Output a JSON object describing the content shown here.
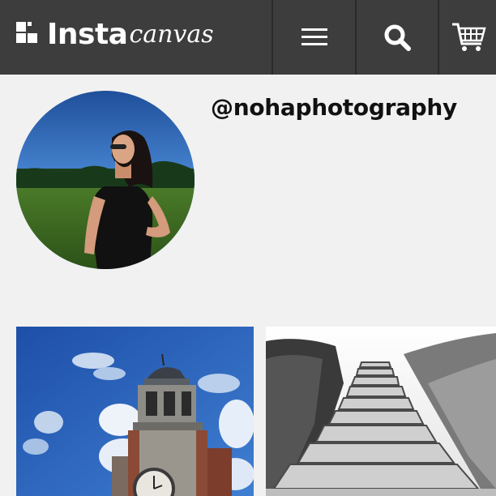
{
  "header": {
    "logo_bold": "Insta",
    "logo_script": "canvas",
    "menu_icon": "hamburger-menu-icon",
    "search_icon": "search-icon",
    "cart_icon": "shopping-cart-icon",
    "background_color": "#3d3d3d"
  },
  "profile": {
    "username": "@nohaphotography"
  },
  "photos": [
    {
      "name": "clock-tower-photo"
    },
    {
      "name": "stone-stairs-photo"
    }
  ]
}
